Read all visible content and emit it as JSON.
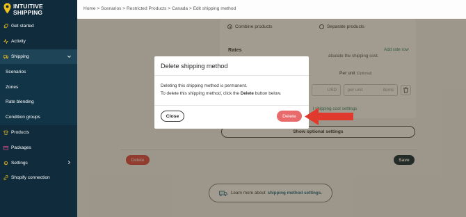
{
  "brand": {
    "line1": "INTUITIVE",
    "line2": "SHIPPING"
  },
  "sidebar": {
    "items": [
      {
        "label": "Get started",
        "icon": "rocket-icon"
      },
      {
        "label": "Activity",
        "icon": "activity-icon"
      },
      {
        "label": "Shipping",
        "icon": "truck-icon",
        "expanded": true
      },
      {
        "label": "Scenarios"
      },
      {
        "label": "Zones"
      },
      {
        "label": "Rate blending"
      },
      {
        "label": "Condition groups"
      },
      {
        "label": "Products",
        "icon": "shirt-icon"
      },
      {
        "label": "Packages",
        "icon": "package-icon"
      },
      {
        "label": "Settings",
        "icon": "gear-icon"
      },
      {
        "label": "Shopify connection",
        "icon": "link-icon"
      }
    ]
  },
  "breadcrumb": "Home > Scenarios > Restricted Products > Canada > Edit shipping method",
  "form": {
    "combine": "Combine products",
    "separate": "Separate products",
    "rates_title": "Rates",
    "rates_desc": "alculate the shipping cost.",
    "add_rate": "Add rate row",
    "per_unit": "Per unit",
    "optional": "(Optional)",
    "currency": "USD",
    "per_unit_placeholder": "per unit",
    "items_suffix": "items",
    "cost_link": "l shipping cost settings",
    "show_optional": "Show optional settings",
    "delete": "Delete",
    "save": "Save",
    "learn_text": "Learn more about",
    "learn_link": "shipping method settings."
  },
  "modal": {
    "title": "Delete shipping method",
    "line1": "Deleting this shipping method is permanent.",
    "line2_pre": "To delete this shipping method, click the",
    "line2_bold": "Delete",
    "line2_post": "button below.",
    "close": "Close",
    "delete": "Delete"
  },
  "colors": {
    "sidebar": "#0f2b3c",
    "accent_green": "#2b8a6b",
    "danger": "#e86a6a",
    "arrow": "#e03a2e"
  }
}
